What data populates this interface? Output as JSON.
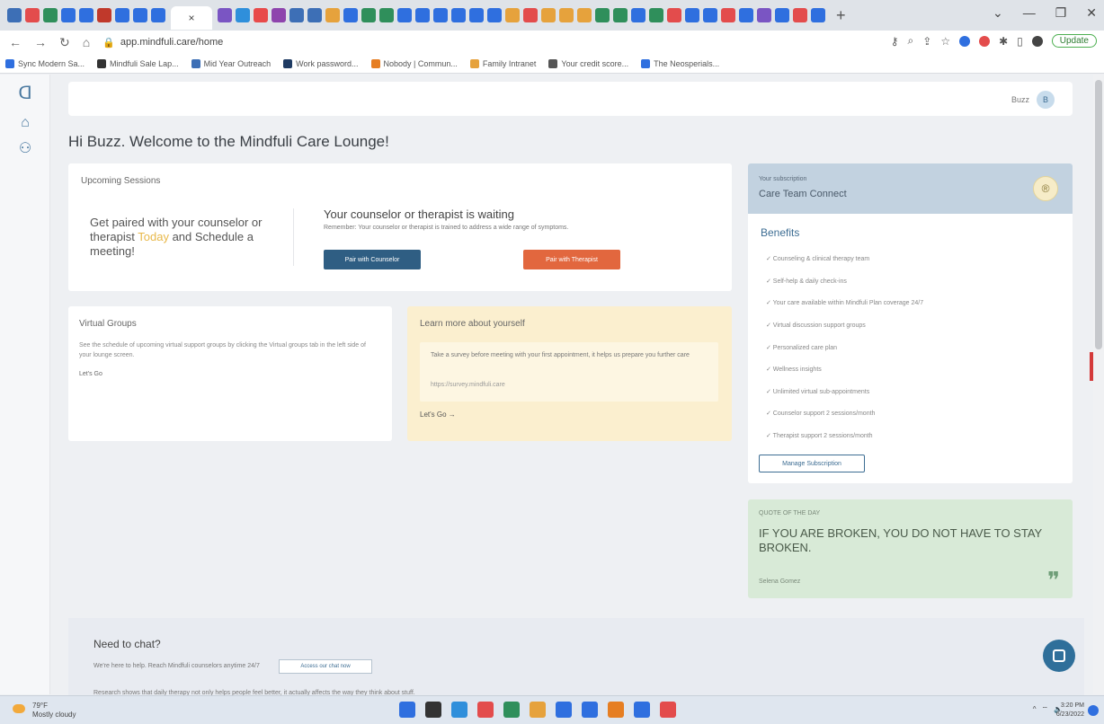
{
  "browser": {
    "tab_colors": [
      "#3d6fb6",
      "#e34c4c",
      "#2f8f5b",
      "#2f6fdf",
      "#2f6fdf",
      "#c0392b",
      "#2f6fdf",
      "#2f6fdf",
      "#2f6fdf",
      "#7a55c3",
      "#2f8fdb",
      "#e84a4a",
      "#8e44ad",
      "#3d6fb6",
      "#3d6fb6",
      "#e6a23c",
      "#2f6fdf",
      "#2f8f5b",
      "#2f8f5b",
      "#2f6fdf",
      "#2f6fdf",
      "#2f6fdf",
      "#2f6fdf",
      "#2f6fdf",
      "#2f6fdf",
      "#e6a23c",
      "#e34c4c",
      "#e6a23c",
      "#e6a23c",
      "#e6a23c",
      "#2f8f5b",
      "#2f8f5b",
      "#2f6fdf",
      "#2f8f5b",
      "#e34c4c",
      "#2f6fdf",
      "#2f6fdf",
      "#e34c4c",
      "#2f6fdf",
      "#7a55c3",
      "#2f6fdf",
      "#e34c4c",
      "#2f6fdf"
    ],
    "active_tab_close": "×",
    "url": "app.mindfuli.care/home",
    "update_label": "Update",
    "bookmarks": [
      {
        "label": "Sync Modern Sa...",
        "color": "#2f6fdf"
      },
      {
        "label": "Mindfuli Sale Lap...",
        "color": "#333333"
      },
      {
        "label": "Mid Year Outreach",
        "color": "#3d6fb6"
      },
      {
        "label": "Work password...",
        "color": "#1f3b63"
      },
      {
        "label": "Nobody | Commun...",
        "color": "#e67e22"
      },
      {
        "label": "Family Intranet",
        "color": "#e6a23c"
      },
      {
        "label": "Your credit score...",
        "color": "#555555"
      },
      {
        "label": "The Neosperials...",
        "color": "#2f6fdf"
      }
    ]
  },
  "sidebar": {
    "items": [
      {
        "icon": "brain-logo-icon",
        "glyph": "ᗡ"
      },
      {
        "icon": "home-icon",
        "glyph": "⌂"
      },
      {
        "icon": "people-icon",
        "glyph": "⚇"
      }
    ]
  },
  "header": {
    "user_name": "Buzz",
    "avatar_initial": "B"
  },
  "welcome": "Hi Buzz. Welcome to the Mindfuli Care Lounge!",
  "upcoming": {
    "title": "Upcoming Sessions",
    "pair_before": "Get paired with your counselor or therapist ",
    "pair_today": "Today",
    "pair_after": " and Schedule a meeting!",
    "wait_title": "Your counselor or therapist is waiting",
    "wait_sub": "Remember: Your counselor or therapist is trained to address a wide range of symptoms.",
    "pair_counselor_btn": "Pair with Counselor",
    "pair_therapist_btn": "Pair with Therapist"
  },
  "virtual_groups": {
    "title": "Virtual Groups",
    "description": "See the schedule of upcoming virtual support groups by clicking the Virtual groups tab in the left side of your lounge screen.",
    "link": "Let's Go"
  },
  "learn": {
    "title": "Learn more about yourself",
    "description": "Take a survey before meeting with your first appointment, it helps us prepare you further care",
    "survey_link": "https://survey.mindfuli.care",
    "go_link": "Let's Go →"
  },
  "subscription": {
    "label": "Your subscription",
    "plan": "Care Team Connect",
    "badge": "®",
    "benefits_title": "Benefits",
    "benefits": [
      "Counseling & clinical therapy team",
      "Self-help & daily check-ins",
      "Your care available within Mindfuli Plan coverage 24/7",
      "Virtual discussion support groups",
      "Personalized care plan",
      "Wellness insights",
      "Unlimited virtual sub-appointments",
      "Counselor support 2 sessions/month",
      "Therapist support 2 sessions/month"
    ],
    "manage_btn": "Manage Subscription"
  },
  "quote": {
    "label": "QUOTE OF THE DAY",
    "text": "IF YOU ARE BROKEN, YOU DO NOT HAVE TO STAY BROKEN.",
    "author": "Selena Gomez",
    "mark": "❞"
  },
  "chat": {
    "title": "Need to chat?",
    "description": "We're here to help. Reach Mindfuli counselors anytime 24/7",
    "button": "Access our chat now",
    "note": "Research shows that daily therapy not only helps people feel better, it actually affects the way they think about stuff."
  },
  "taskbar": {
    "temp": "79°F",
    "weather": "Mostly cloudy",
    "apps": [
      "#2f6fdf",
      "#333333",
      "#2f8fdb",
      "#e34c4c",
      "#2f8f5b",
      "#e6a23c",
      "#2f6fdf",
      "#2f6fdf",
      "#e67e22",
      "#2f6fdf",
      "#e34c4c"
    ],
    "time": "3:20 PM",
    "date": "6/23/2022"
  }
}
